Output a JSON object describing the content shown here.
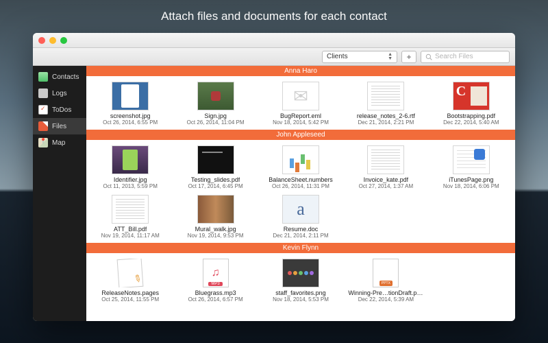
{
  "banner": "Attach files and documents for each contact",
  "toolbar": {
    "selector_value": "Clients",
    "search_placeholder": "Search Files"
  },
  "sidebar": {
    "items": [
      {
        "label": "Contacts",
        "icon": "ic-contacts"
      },
      {
        "label": "Logs",
        "icon": "ic-logs"
      },
      {
        "label": "ToDos",
        "icon": "ic-todos"
      },
      {
        "label": "Files",
        "icon": "ic-files",
        "active": true
      },
      {
        "label": "Map",
        "icon": "ic-map"
      }
    ]
  },
  "sections": [
    {
      "contact": "Anna Haro",
      "files": [
        {
          "name": "screenshot.jpg",
          "date": "Oct 26, 2014, 6:55 PM",
          "thumb": "th-screenshot"
        },
        {
          "name": "Sign.jpg",
          "date": "Oct 26, 2014, 11:04 PM",
          "thumb": "th-sign"
        },
        {
          "name": "BugReport.eml",
          "date": "Nov 18, 2014, 5:42 PM",
          "thumb": "th-eml"
        },
        {
          "name": "release_notes_2-6.rtf",
          "date": "Dec 21, 2014, 2:21 PM",
          "thumb": "th-doc"
        },
        {
          "name": "Bootstrapping.pdf",
          "date": "Dec 22, 2014, 5:40 AM",
          "thumb": "th-boot"
        }
      ]
    },
    {
      "contact": "John Appleseed",
      "files": [
        {
          "name": "Identifier.jpg",
          "date": "Oct 11, 2013, 5:59 PM",
          "thumb": "th-ident"
        },
        {
          "name": "Testing_slides.pdf",
          "date": "Oct 17, 2014, 6:45 PM",
          "thumb": "th-slides"
        },
        {
          "name": "BalanceSheet.numbers",
          "date": "Oct 26, 2014, 11:31 PM",
          "thumb": "th-chart"
        },
        {
          "name": "Invoice_kate.pdf",
          "date": "Oct 27, 2014, 1:37 AM",
          "thumb": "th-doc"
        },
        {
          "name": "iTunesPage.png",
          "date": "Nov 18, 2014, 6:06 PM",
          "thumb": "th-itunes"
        },
        {
          "name": "ATT_Bill.pdf",
          "date": "Nov 19, 2014, 11:17 AM",
          "thumb": "th-doc"
        },
        {
          "name": "Mural_walk.jpg",
          "date": "Nov 19, 2014, 9:53 PM",
          "thumb": "th-mural"
        },
        {
          "name": "Resume.doc",
          "date": "Dec 21, 2014, 2:11 PM",
          "thumb": "th-font"
        }
      ]
    },
    {
      "contact": "Kevin Flynn",
      "files": [
        {
          "name": "ReleaseNotes.pages",
          "date": "Oct 25, 2014, 11:55 PM",
          "thumb": "th-pages"
        },
        {
          "name": "Bluegrass.mp3",
          "date": "Oct 26, 2014, 6:57 PM",
          "thumb": "th-mp3"
        },
        {
          "name": "staff_favorites.png",
          "date": "Nov 18, 2014, 5:53 PM",
          "thumb": "th-strip"
        },
        {
          "name": "Winning-Pre…tionDraft.pptx",
          "date": "Dec 22, 2014, 5:39 AM",
          "thumb": "th-pptx"
        }
      ]
    }
  ]
}
